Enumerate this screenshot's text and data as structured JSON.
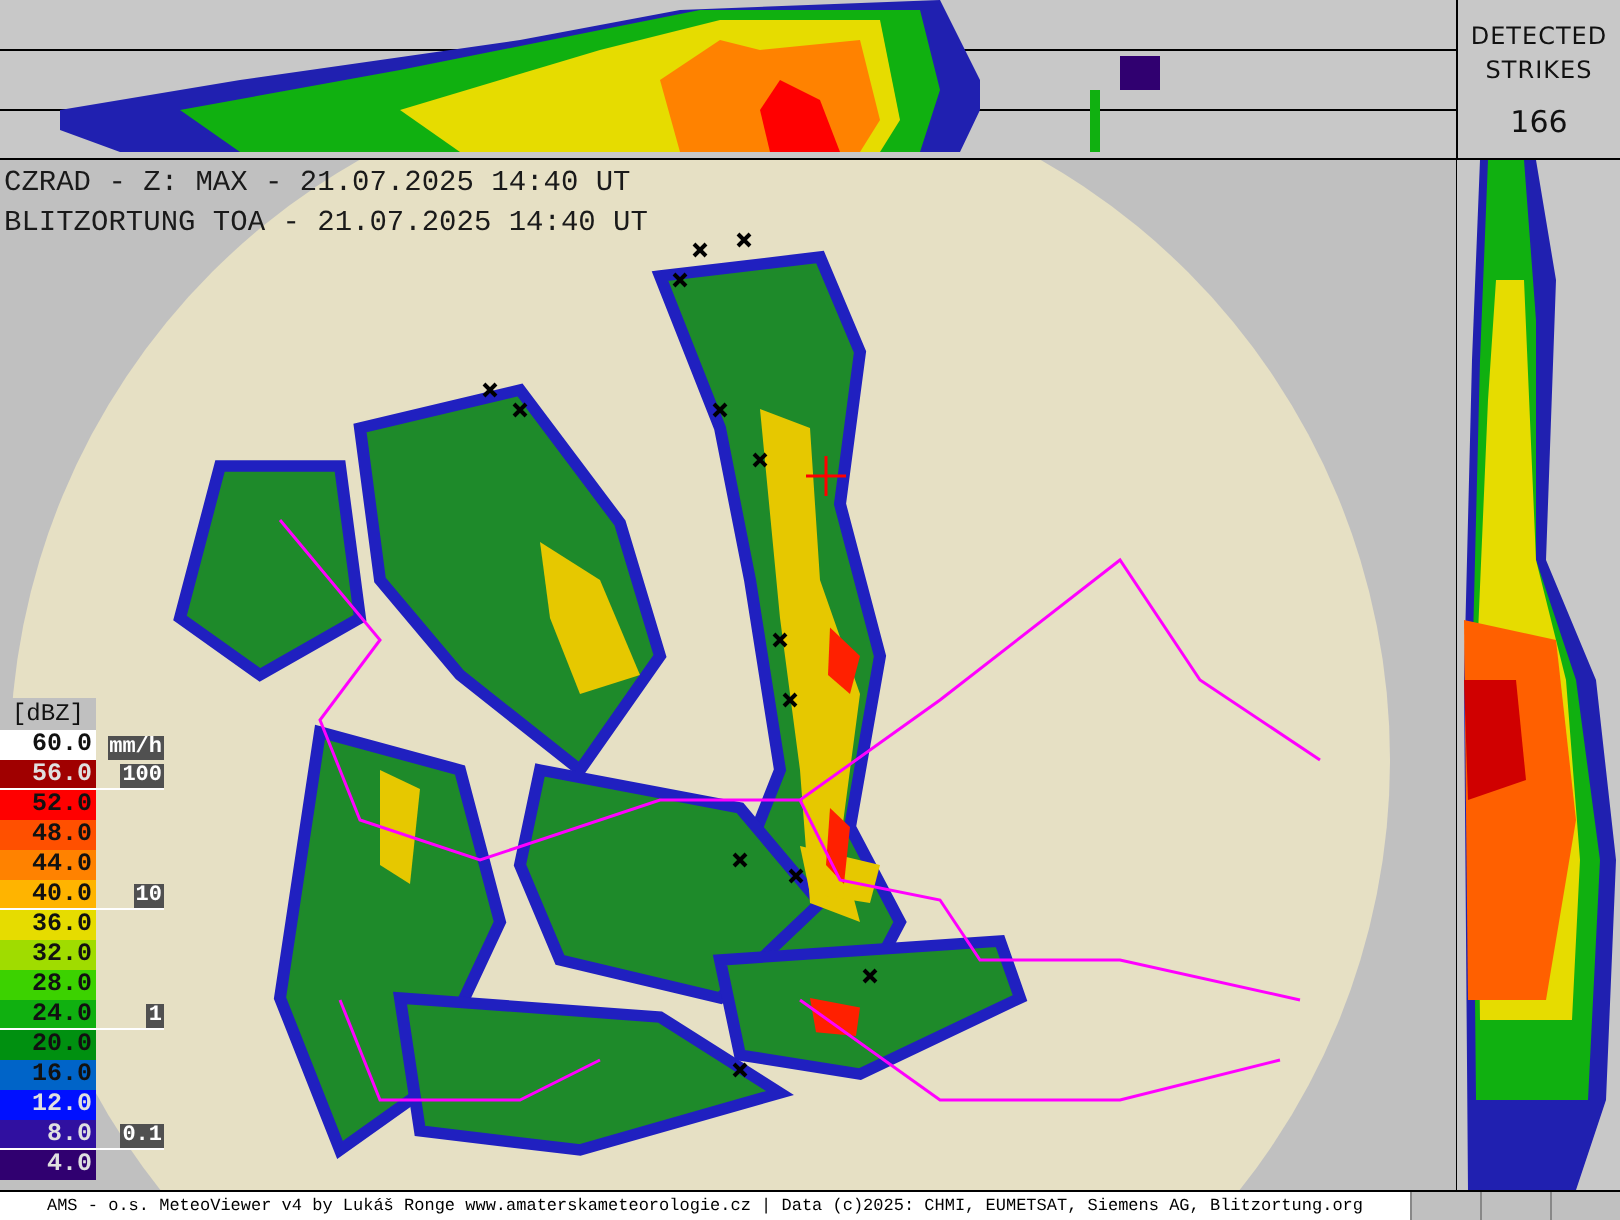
{
  "titles": [
    "CZRAD - Z: MAX - 21.07.2025 14:40 UT",
    "BLITZORTUNG TOA - 21.07.2025 14:40 UT"
  ],
  "strikes": {
    "label": "DETECTED STRIKES",
    "count": "166"
  },
  "legend": {
    "unit": "[dBZ]",
    "rate_unit": "mm/h",
    "items": [
      {
        "value": "60.0",
        "color": "#ffffff"
      },
      {
        "value": "56.0",
        "color": "#a00000",
        "rate": "100"
      },
      {
        "value": "52.0",
        "color": "#ff0000"
      },
      {
        "value": "48.0",
        "color": "#ff5000"
      },
      {
        "value": "44.0",
        "color": "#ff8200"
      },
      {
        "value": "40.0",
        "color": "#ffb400",
        "rate": "10"
      },
      {
        "value": "36.0",
        "color": "#e6dc00"
      },
      {
        "value": "32.0",
        "color": "#a0dc00"
      },
      {
        "value": "28.0",
        "color": "#3cd200"
      },
      {
        "value": "24.0",
        "color": "#10b010",
        "rate": "1"
      },
      {
        "value": "20.0",
        "color": "#009010"
      },
      {
        "value": "16.0",
        "color": "#0064c8"
      },
      {
        "value": "12.0",
        "color": "#0010ff"
      },
      {
        "value": "8.0",
        "color": "#3010a0",
        "rate": "0.1"
      },
      {
        "value": "4.0",
        "color": "#300070"
      }
    ]
  },
  "footer": "AMS - o.s. MeteoViewer v4 by Lukáš Ronge www.amaterskameteorologie.cz | Data (c)2025: CHMI, EUMETSAT, Siemens AG, Blitzortung.org"
}
